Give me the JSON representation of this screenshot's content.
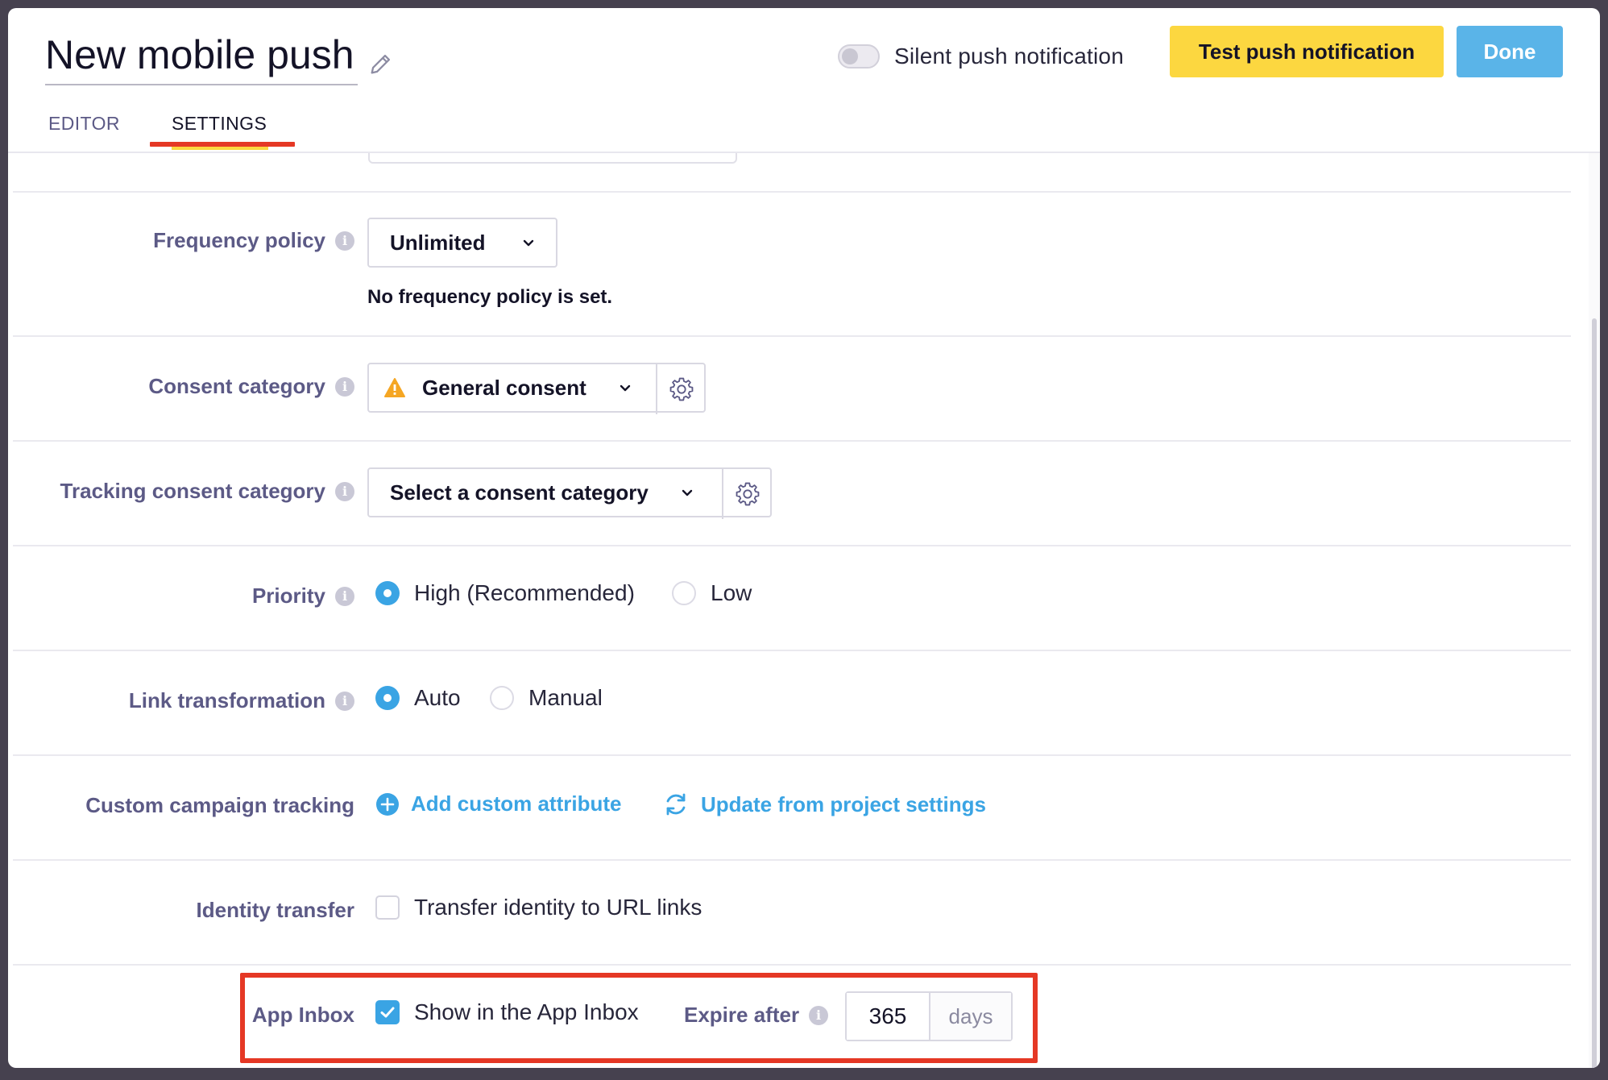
{
  "header": {
    "title": "New mobile push",
    "silent_push_label": "Silent push notification",
    "silent_push_on": false,
    "test_button_label": "Test push notification",
    "done_button_label": "Done"
  },
  "tabs": [
    {
      "label": "EDITOR",
      "active": false
    },
    {
      "label": "SETTINGS",
      "active": true
    }
  ],
  "settings": {
    "frequency_policy": {
      "label": "Frequency policy",
      "value": "Unlimited",
      "note": "No frequency policy is set."
    },
    "consent_category": {
      "label": "Consent category",
      "value": "General consent",
      "warning_icon": "warning-triangle-icon"
    },
    "tracking_consent_category": {
      "label": "Tracking consent category",
      "placeholder": "Select a consent category"
    },
    "priority": {
      "label": "Priority",
      "options": [
        "High (Recommended)",
        "Low"
      ],
      "selected": "High (Recommended)"
    },
    "link_transformation": {
      "label": "Link transformation",
      "options": [
        "Auto",
        "Manual"
      ],
      "selected": "Auto"
    },
    "custom_campaign_tracking": {
      "label": "Custom campaign tracking",
      "add_link": "Add custom attribute",
      "update_link": "Update from project settings"
    },
    "identity_transfer": {
      "label": "Identity transfer",
      "checkbox_label": "Transfer identity to URL links",
      "checked": false
    },
    "app_inbox": {
      "label": "App Inbox",
      "checkbox_label": "Show in the App Inbox",
      "checked": true,
      "expire_label": "Expire after",
      "expire_value": "365",
      "expire_unit": "days"
    }
  },
  "colors": {
    "accent_blue": "#3aa4e4",
    "done_blue": "#5ab4e8",
    "test_yellow": "#fcd740",
    "highlight_red": "#e53825",
    "label_purple": "#5c5a86",
    "warning_orange": "#f5a623"
  }
}
